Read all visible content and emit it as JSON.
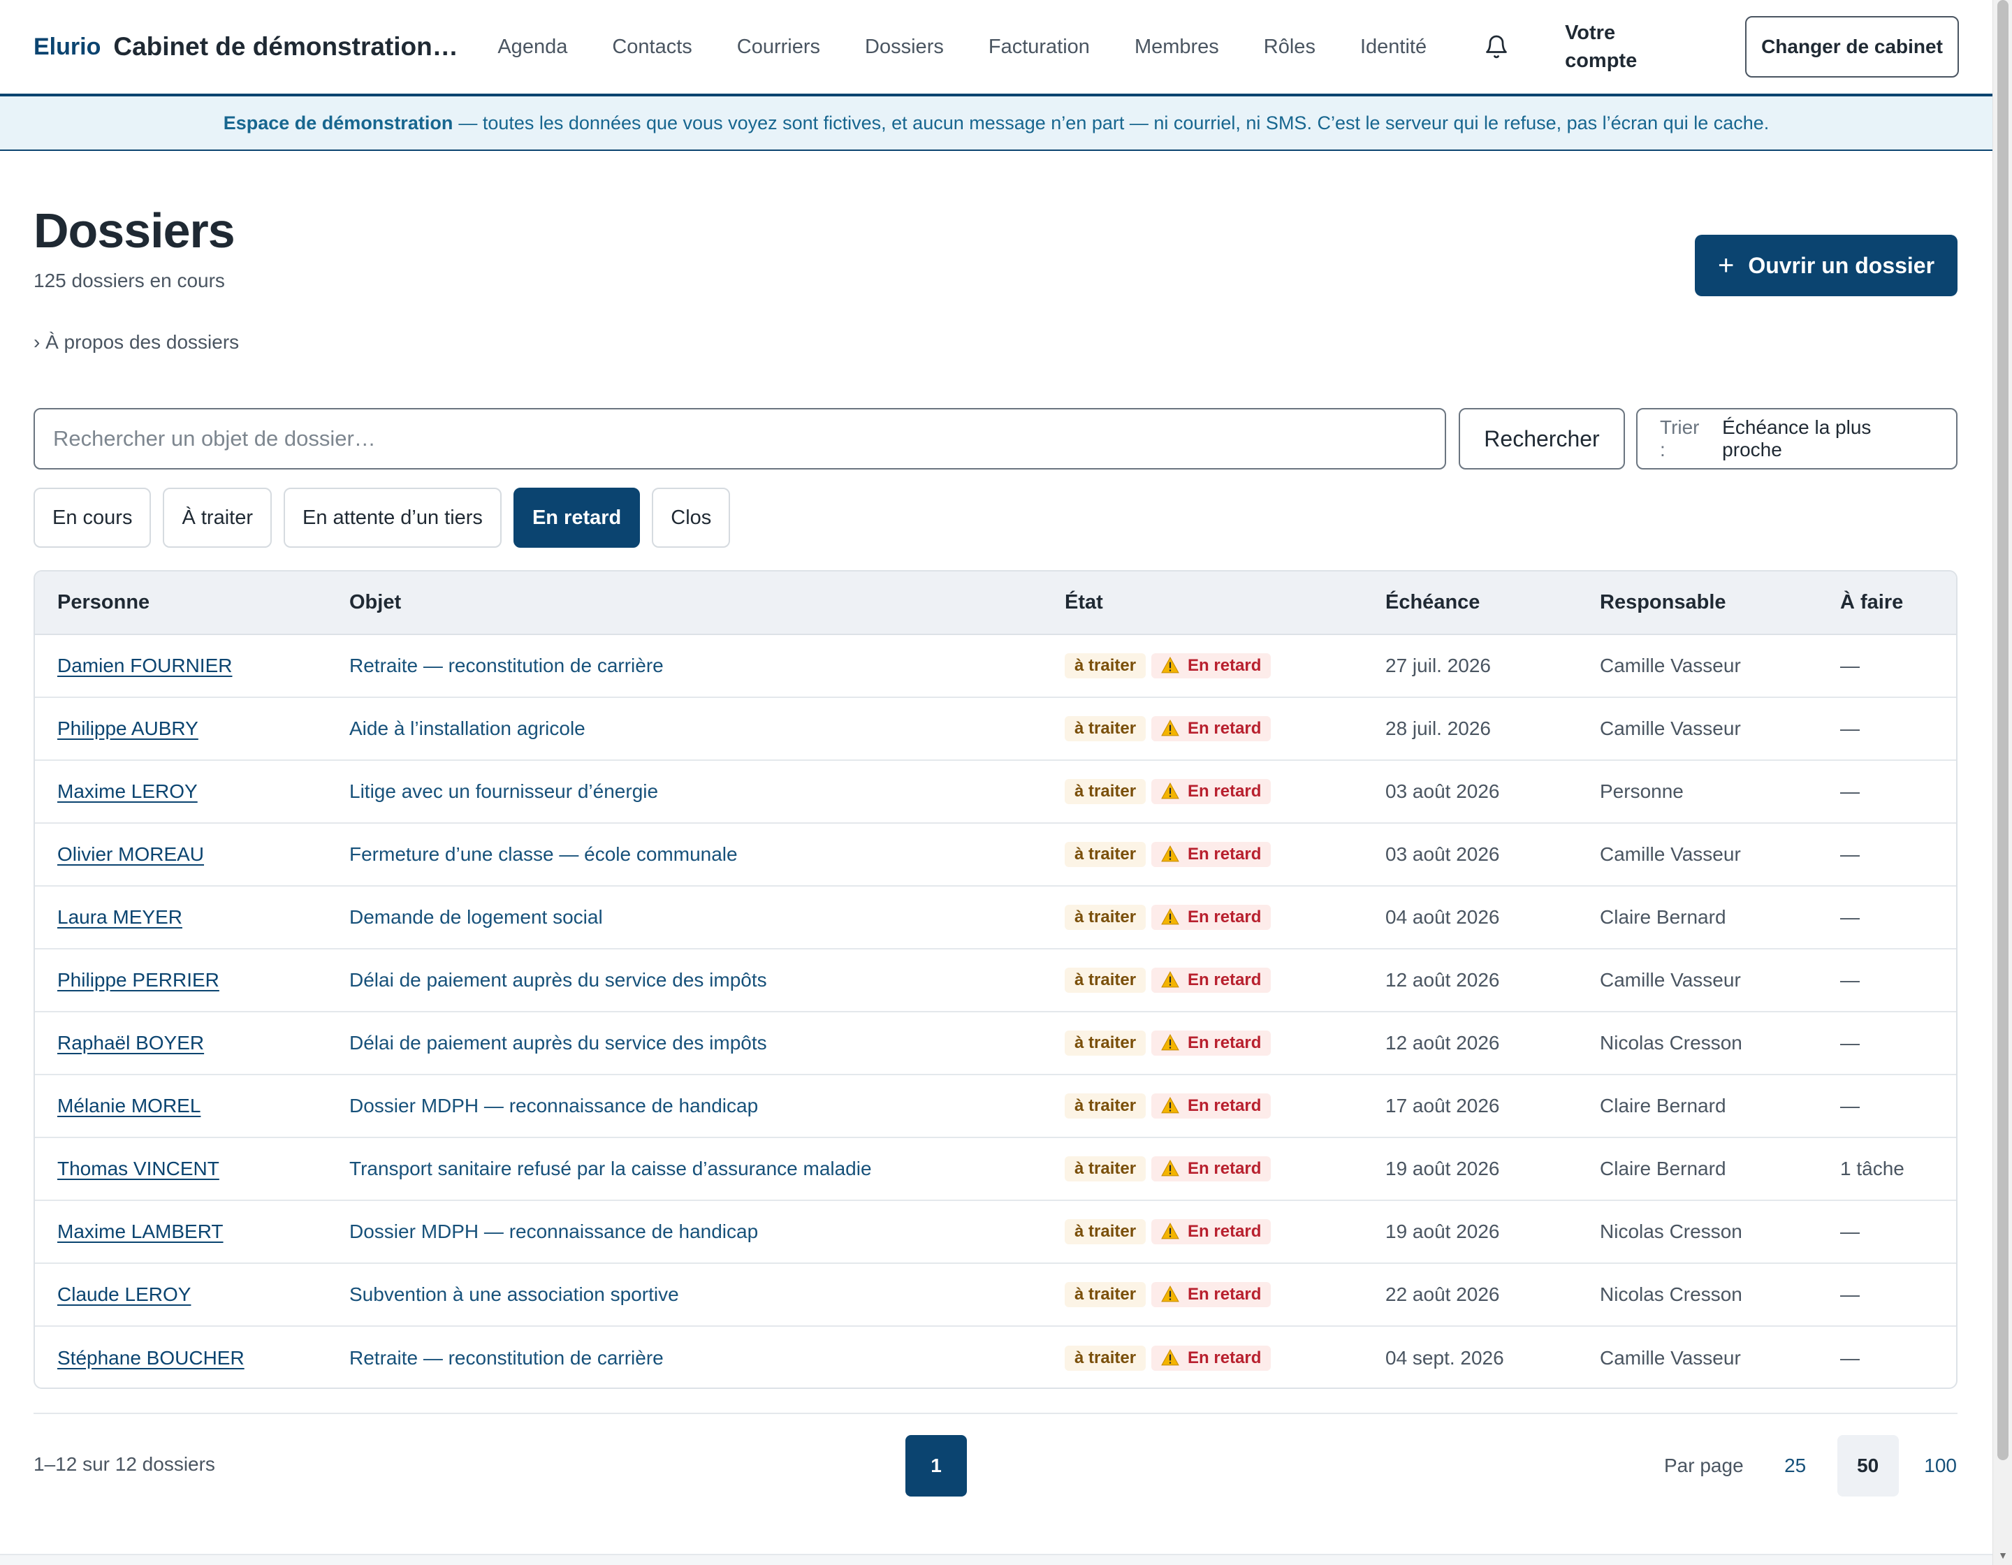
{
  "nav": {
    "brand": "Elurio",
    "cabinet": "Cabinet de démonstration El...",
    "links": [
      "Agenda",
      "Contacts",
      "Courriers",
      "Dossiers",
      "Facturation",
      "Membres",
      "Rôles",
      "Identité"
    ],
    "bell_icon": "bell-icon",
    "account": "Votre compte",
    "switch_label": "Changer de cabinet"
  },
  "banner": {
    "strong": "Espace de démonstration",
    "text": "— toutes les données que vous voyez sont fictives, et aucun message n’en part — ni courriel, ni SMS. C’est le serveur qui le refuse, pas l’écran qui le cache."
  },
  "header": {
    "title": "Dossiers",
    "count": "125 dossiers en cours",
    "about": "› À propos des dossiers",
    "open_button": "Ouvrir un dossier",
    "open_icon": "+"
  },
  "search": {
    "placeholder": "Rechercher un objet de dossier…",
    "value": "",
    "button": "Rechercher",
    "sort_label": "Trier :",
    "sort_value": "Échéance la plus proche"
  },
  "filters": [
    {
      "label": "En cours",
      "active": false
    },
    {
      "label": "À traiter",
      "active": false
    },
    {
      "label": "En attente d’un tiers",
      "active": false
    },
    {
      "label": "En retard",
      "active": true
    },
    {
      "label": "Clos",
      "active": false
    }
  ],
  "table": {
    "columns": [
      "Personne",
      "Objet",
      "État",
      "Échéance",
      "Responsable",
      "À faire"
    ],
    "status_todo": "à traiter",
    "status_late": "En retard",
    "status_late_icon": "warning-icon",
    "rows": [
      {
        "personne": "Damien FOURNIER",
        "objet": "Retraite — reconstitution de carrière",
        "echeance": "27 juil. 2026",
        "responsable": "Camille Vasseur",
        "a_faire": "—"
      },
      {
        "personne": "Philippe AUBRY",
        "objet": "Aide à l’installation agricole",
        "echeance": "28 juil. 2026",
        "responsable": "Camille Vasseur",
        "a_faire": "—"
      },
      {
        "personne": "Maxime LEROY",
        "objet": "Litige avec un fournisseur d’énergie",
        "echeance": "03 août 2026",
        "responsable": "Personne",
        "a_faire": "—"
      },
      {
        "personne": "Olivier MOREAU",
        "objet": "Fermeture d’une classe — école communale",
        "echeance": "03 août 2026",
        "responsable": "Camille Vasseur",
        "a_faire": "—"
      },
      {
        "personne": "Laura MEYER",
        "objet": "Demande de logement social",
        "echeance": "04 août 2026",
        "responsable": "Claire Bernard",
        "a_faire": "—"
      },
      {
        "personne": "Philippe PERRIER",
        "objet": "Délai de paiement auprès du service des impôts",
        "echeance": "12 août 2026",
        "responsable": "Camille Vasseur",
        "a_faire": "—"
      },
      {
        "personne": "Raphaël BOYER",
        "objet": "Délai de paiement auprès du service des impôts",
        "echeance": "12 août 2026",
        "responsable": "Nicolas Cresson",
        "a_faire": "—"
      },
      {
        "personne": "Mélanie MOREL",
        "objet": "Dossier MDPH — reconnaissance de handicap",
        "echeance": "17 août 2026",
        "responsable": "Claire Bernard",
        "a_faire": "—"
      },
      {
        "personne": "Thomas VINCENT",
        "objet": "Transport sanitaire refusé par la caisse d’assurance maladie",
        "echeance": "19 août 2026",
        "responsable": "Claire Bernard",
        "a_faire": "1 tâche"
      },
      {
        "personne": "Maxime LAMBERT",
        "objet": "Dossier MDPH — reconnaissance de handicap",
        "echeance": "19 août 2026",
        "responsable": "Nicolas Cresson",
        "a_faire": "—"
      },
      {
        "personne": "Claude LEROY",
        "objet": "Subvention à une association sportive",
        "echeance": "22 août 2026",
        "responsable": "Nicolas Cresson",
        "a_faire": "—"
      },
      {
        "personne": "Stéphane BOUCHER",
        "objet": "Retraite — reconstitution de carrière",
        "echeance": "04 sept. 2026",
        "responsable": "Camille Vasseur",
        "a_faire": "—"
      }
    ]
  },
  "pagination": {
    "range": "1–12 sur 12 dossiers",
    "current_page": "1",
    "per_page_label": "Par page",
    "per_page_options": [
      "25",
      "50",
      "100"
    ],
    "per_page_selected": "50"
  },
  "colors": {
    "brand": "#0b4470",
    "banner_bg": "#e8f3f9",
    "todo_bg": "#fcf4e6",
    "late_bg": "#fdecea",
    "late_text": "#b8202e"
  }
}
